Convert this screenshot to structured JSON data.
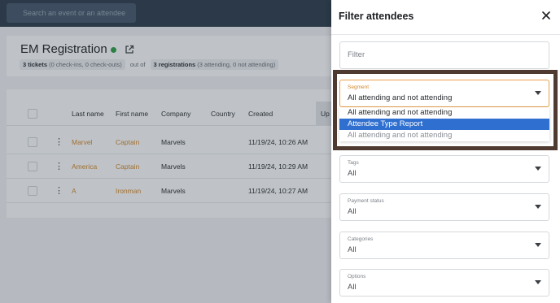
{
  "search": {
    "placeholder": "Search an event or an attendee"
  },
  "event": {
    "title": "EM Registration",
    "stats": {
      "tickets_count": "3 tickets",
      "tickets_detail": "(0 check-ins, 0 check-outs)",
      "out_of": "out of",
      "registrations_count": "3 registrations",
      "registrations_detail": "(3 attending, 0 not attending)"
    }
  },
  "table": {
    "headers": [
      "Last name",
      "First name",
      "Company",
      "Country",
      "Created",
      "Up"
    ],
    "rows": [
      {
        "last": "Marvel",
        "first": "Captain",
        "company": "Marvels",
        "country": "",
        "created": "11/19/24, 10:26 AM"
      },
      {
        "last": "America",
        "first": "Captain",
        "company": "Marvels",
        "country": "",
        "created": "11/19/24, 10:29 AM"
      },
      {
        "last": "A",
        "first": "Ironman",
        "company": "Marvels",
        "country": "",
        "created": "11/19/24, 10:27 AM"
      }
    ]
  },
  "panel": {
    "title": "Filter attendees",
    "filter_placeholder": "Filter",
    "segment": {
      "label": "Segment",
      "value": "All attending and not attending",
      "options": [
        "All attending and not attending",
        "Attendee Type Report",
        "All attending and not attending"
      ],
      "selected_index": 1
    },
    "fields": [
      {
        "label": "Tags",
        "value": "All"
      },
      {
        "label": "Payment status",
        "value": "All"
      },
      {
        "label": "Categories",
        "value": "All"
      },
      {
        "label": "Options",
        "value": "All"
      }
    ]
  },
  "colors": {
    "accent_orange": "#d4882a",
    "selected_blue": "#2f6fcf",
    "highlight_border": "#4e3a30",
    "live_green": "#2ea043",
    "topbar": "#2b3a4a"
  }
}
